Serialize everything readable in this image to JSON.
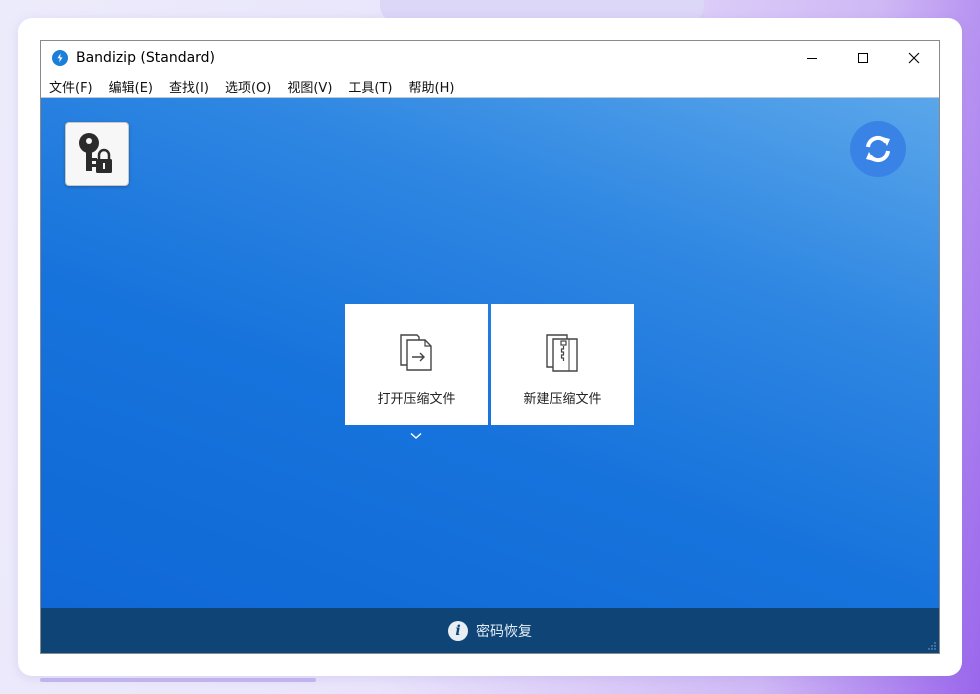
{
  "window": {
    "title": "Bandizip (Standard)",
    "app_icon": "bandizip-icon",
    "controls": [
      "minimize-icon",
      "maximize-icon",
      "close-icon"
    ]
  },
  "menubar": {
    "items": [
      {
        "label": "文件(F)"
      },
      {
        "label": "编辑(E)"
      },
      {
        "label": "查找(I)"
      },
      {
        "label": "选项(O)"
      },
      {
        "label": "视图(V)"
      },
      {
        "label": "工具(T)"
      },
      {
        "label": "帮助(H)"
      }
    ]
  },
  "main": {
    "key_tile_icon": "key-lock-icon",
    "refresh_icon": "refresh-icon",
    "actions": [
      {
        "label": "打开压缩文件",
        "icon": "open-archive-icon"
      },
      {
        "label": "新建压缩文件",
        "icon": "new-archive-icon"
      }
    ],
    "dropdown_icon": "chevron-down-icon"
  },
  "footer": {
    "label": "密码恢复",
    "icon": "info-icon"
  },
  "colors": {
    "accent": "#1773dc",
    "footer_bg": "#0f4576",
    "refresh_bg": "#3a83e6"
  }
}
